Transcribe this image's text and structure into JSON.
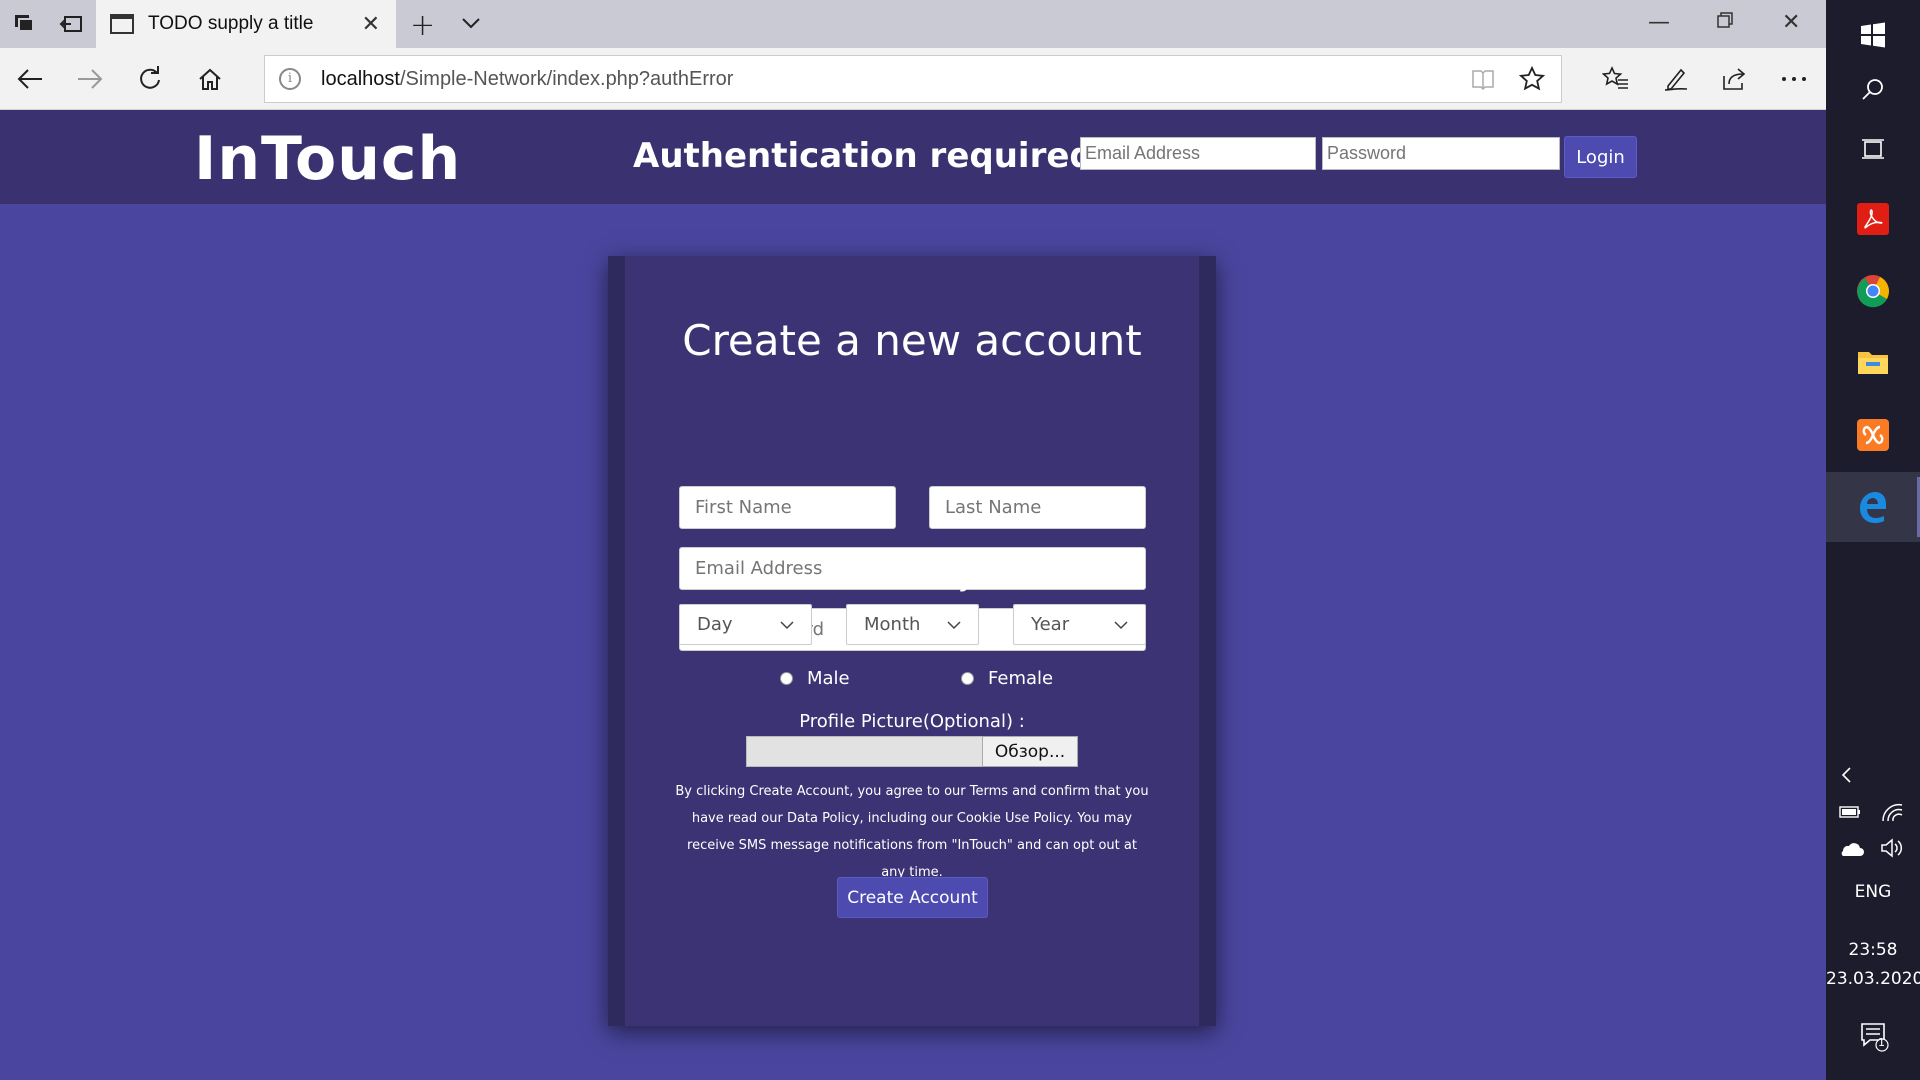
{
  "browser": {
    "tab_title": "TODO supply a title",
    "url_host": "localhost",
    "url_path": "/Simple-Network/index.php?authError"
  },
  "header": {
    "brand": "InTouch",
    "auth_message": "Authentication required",
    "email_placeholder": "Email Address",
    "password_placeholder": "Password",
    "login_label": "Login"
  },
  "signup": {
    "title": "Create a new account",
    "first_name_placeholder": "First Name",
    "last_name_placeholder": "Last Name",
    "email_placeholder": "Email Address",
    "password_placeholder": "New Password",
    "birthday_label": "Birthday",
    "day_label": "Day",
    "month_label": "Month",
    "year_label": "Year",
    "gender_male": "Male",
    "gender_female": "Female",
    "profile_picture_label": "Profile Picture(Optional) :",
    "browse_label": "Обзор...",
    "policy_text": "By clicking Create Account, you agree to our Terms and confirm that you have read our Data Policy, including our Cookie Use Policy. You may receive SMS message notifications from \"InTouch\" and can opt out at any time.",
    "create_label": "Create Account"
  },
  "taskbar": {
    "language": "ENG",
    "time": "23:58",
    "date": "23.03.2020",
    "notification_count": "1"
  },
  "colors": {
    "page_bg": "#4a469f",
    "header_bg": "#3a3270",
    "card_bg": "#3b3373",
    "button_bg": "#4d4bb0"
  }
}
